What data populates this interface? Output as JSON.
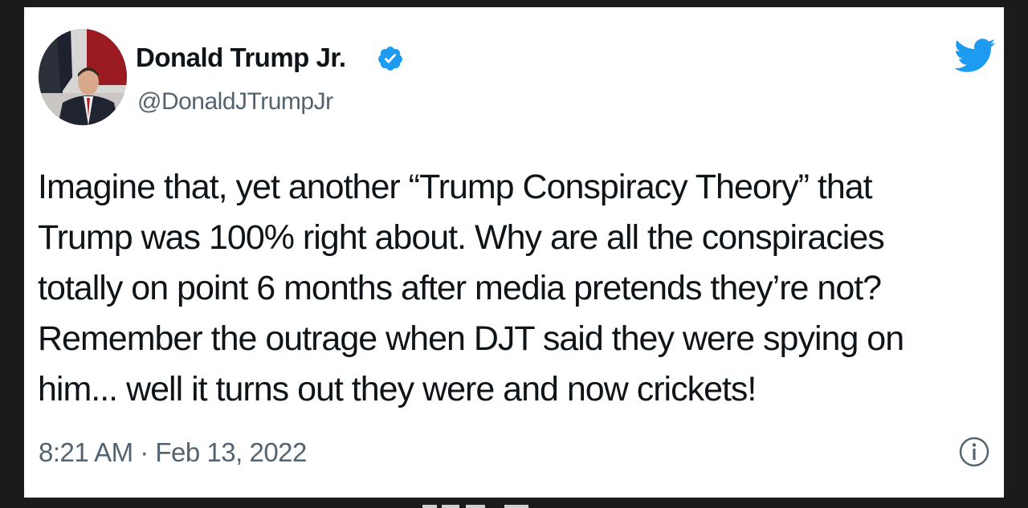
{
  "tweet": {
    "display_name": "Donald Trump Jr.",
    "handle": "@DonaldJTrumpJr",
    "verified_icon": "verified-badge-icon",
    "brand_icon": "twitter-bird-icon",
    "text_lines": [
      "Imagine that, yet another “Trump Conspiracy Theory” that",
      "Trump was 100% right about. Why are all the conspiracies",
      "totally on point 6 months after media pretends they’re not?",
      "Remember the outrage when DJT said they were spying on",
      "him... well it turns out they were and now crickets!"
    ],
    "timestamp": "8:21 AM · Feb 13, 2022",
    "info_icon": "info-icon"
  },
  "colors": {
    "twitter_blue": "#1d9bf0",
    "text_primary": "#0f1419",
    "text_secondary": "#536471",
    "page_background": "#1b1b1b",
    "card_background": "#ffffff"
  }
}
